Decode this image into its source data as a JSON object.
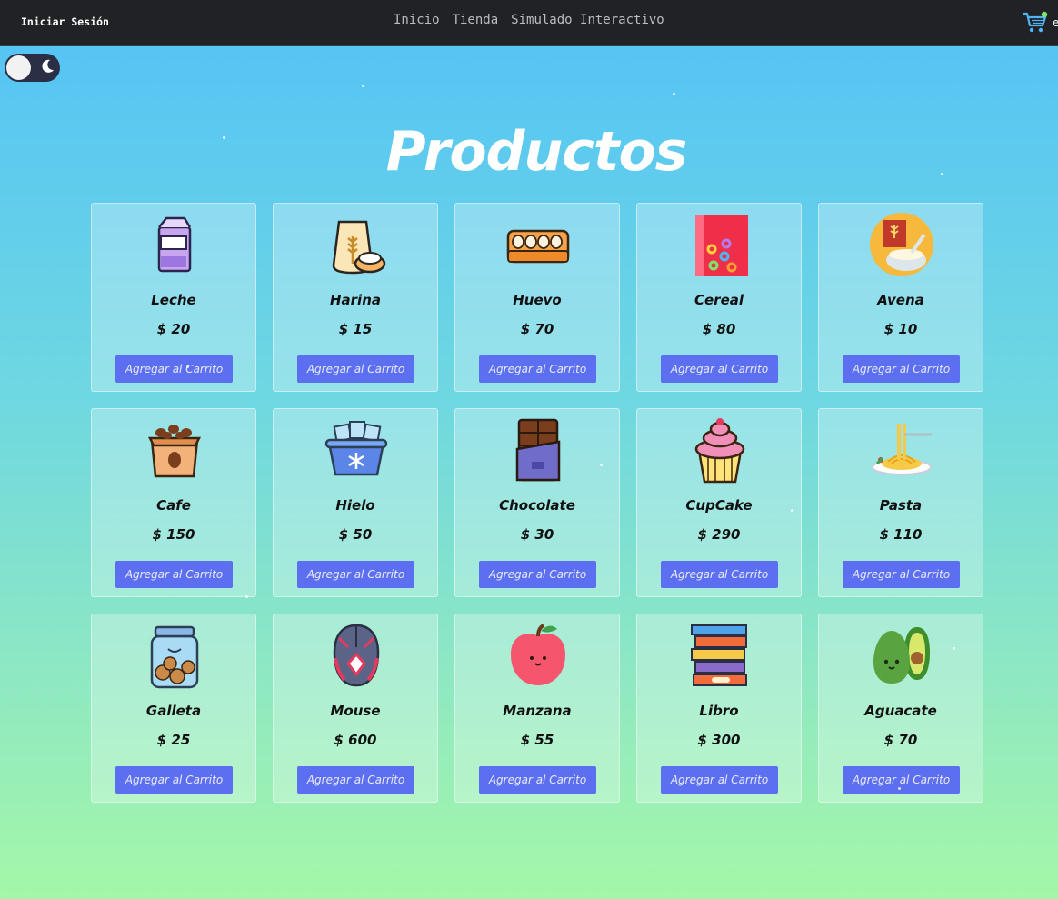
{
  "header": {
    "login_label": "Iniciar Sesión",
    "nav": [
      "Inicio",
      "Tienda",
      "Simulado Interactivo"
    ],
    "cart_icon": "shopping-cart-icon",
    "cart_edge_text": "e"
  },
  "theme_toggle": {
    "icon": "moon-icon",
    "state": "light"
  },
  "page_title": "Productos",
  "products": [
    {
      "name": "Leche",
      "price": "$ 20",
      "icon": "milk-carton-icon"
    },
    {
      "name": "Harina",
      "price": "$ 15",
      "icon": "flour-sack-icon"
    },
    {
      "name": "Huevo",
      "price": "$ 70",
      "icon": "egg-carton-icon"
    },
    {
      "name": "Cereal",
      "price": "$ 80",
      "icon": "cereal-box-icon"
    },
    {
      "name": "Avena",
      "price": "$ 10",
      "icon": "oat-bowl-icon"
    },
    {
      "name": "Cafe",
      "price": "$ 150",
      "icon": "coffee-bag-icon"
    },
    {
      "name": "Hielo",
      "price": "$ 50",
      "icon": "ice-bucket-icon"
    },
    {
      "name": "Chocolate",
      "price": "$ 30",
      "icon": "chocolate-bar-icon"
    },
    {
      "name": "CupCake",
      "price": "$ 290",
      "icon": "cupcake-icon"
    },
    {
      "name": "Pasta",
      "price": "$ 110",
      "icon": "pasta-plate-icon"
    },
    {
      "name": "Galleta",
      "price": "$ 25",
      "icon": "cookie-jar-icon"
    },
    {
      "name": "Mouse",
      "price": "$ 600",
      "icon": "gaming-mouse-icon"
    },
    {
      "name": "Manzana",
      "price": "$ 55",
      "icon": "apple-icon"
    },
    {
      "name": "Libro",
      "price": "$ 300",
      "icon": "book-stack-icon"
    },
    {
      "name": "Aguacate",
      "price": "$ 70",
      "icon": "avocado-icon"
    }
  ],
  "add_to_cart_label": "Agregar al Carrito",
  "colors": {
    "button": "#5b6ff0",
    "header": "#202225",
    "bg_top": "#53c2f7",
    "bg_bottom": "#a4f7a8"
  }
}
